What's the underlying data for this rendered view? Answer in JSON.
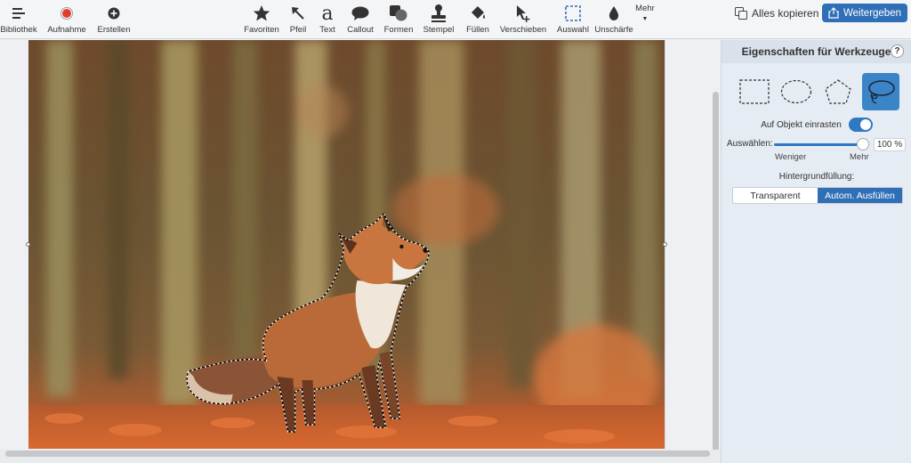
{
  "toolbar": {
    "left": [
      {
        "label": "Bibliothek",
        "icon": "library-menu-icon"
      },
      {
        "label": "Aufnahme",
        "icon": "record-icon"
      },
      {
        "label": "Erstellen",
        "icon": "create-plus-icon"
      }
    ],
    "tools": [
      {
        "label": "Favoriten",
        "icon": "star-icon"
      },
      {
        "label": "Pfeil",
        "icon": "arrow-icon"
      },
      {
        "label": "Text",
        "icon": "text-icon"
      },
      {
        "label": "Callout",
        "icon": "callout-icon"
      },
      {
        "label": "Formen",
        "icon": "shapes-icon"
      },
      {
        "label": "Stempel",
        "icon": "stamp-icon"
      },
      {
        "label": "Füllen",
        "icon": "fill-bucket-icon"
      },
      {
        "label": "Verschieben",
        "icon": "move-icon"
      },
      {
        "label": "Auswahl",
        "icon": "selection-icon"
      },
      {
        "label": "Unschärfe",
        "icon": "blur-drop-icon"
      }
    ],
    "more_label": "Mehr",
    "copy_all_label": "Alles kopieren",
    "share_label": "Weitergeben"
  },
  "panel": {
    "title": "Eigenschaften für Werkzeuge",
    "help_label": "?",
    "selection_shapes": [
      "rectangle-select-icon",
      "ellipse-select-icon",
      "polygon-select-icon",
      "lasso-select-icon"
    ],
    "active_shape": "lasso-select-icon",
    "snap_label": "Auf Objekt einrasten",
    "snap_on": true,
    "select_label": "Auswählen:",
    "select_value": "100 %",
    "select_fraction": 1.0,
    "less_label": "Weniger",
    "more_label": "Mehr",
    "bg_fill_title": "Hintergrundfüllung:",
    "bg_options": [
      "Transparent",
      "Autom. Ausfüllen"
    ],
    "bg_selected": "Autom. Ausfüllen"
  },
  "colors": {
    "accent": "#2f6fb7",
    "record": "#e23b2e"
  }
}
